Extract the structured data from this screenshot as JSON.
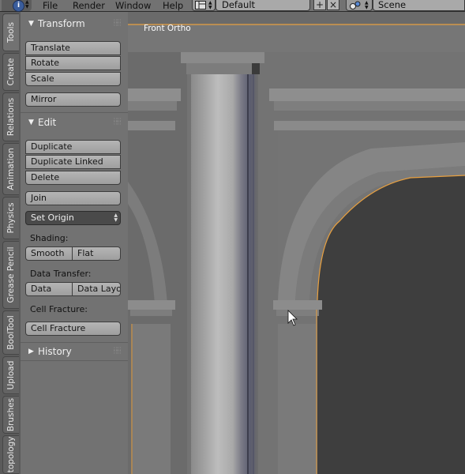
{
  "topbar": {
    "menus": [
      "File",
      "Render",
      "Window",
      "Help"
    ],
    "layout_value": "Default",
    "scene_value": "Scene",
    "info_icon": "info-icon",
    "layout_icon": "screen-layout-icon",
    "scene_icon": "scene-icon",
    "add_icon": "plus-icon",
    "remove_icon": "x-icon"
  },
  "tabs": [
    "Tools",
    "Create",
    "Relations",
    "Animation",
    "Physics",
    "Grease Pencil",
    "BoolTool",
    "Upload",
    "Brushes",
    "Retopology"
  ],
  "panel": {
    "transform": {
      "title": "Transform",
      "buttons": [
        "Translate",
        "Rotate",
        "Scale"
      ],
      "mirror": "Mirror"
    },
    "edit": {
      "title": "Edit",
      "buttons": [
        "Duplicate",
        "Duplicate Linked",
        "Delete"
      ],
      "join": "Join",
      "set_origin": "Set Origin",
      "shading_label": "Shading:",
      "smooth": "Smooth",
      "flat": "Flat",
      "data_transfer_label": "Data Transfer:",
      "data": "Data",
      "data_layout": "Data Layo",
      "cell_fracture_label": "Cell Fracture:",
      "cell_fracture": "Cell Fracture"
    },
    "history": {
      "title": "History"
    }
  },
  "viewport": {
    "label": "Front Ortho",
    "selection_color": "#f0a030"
  }
}
